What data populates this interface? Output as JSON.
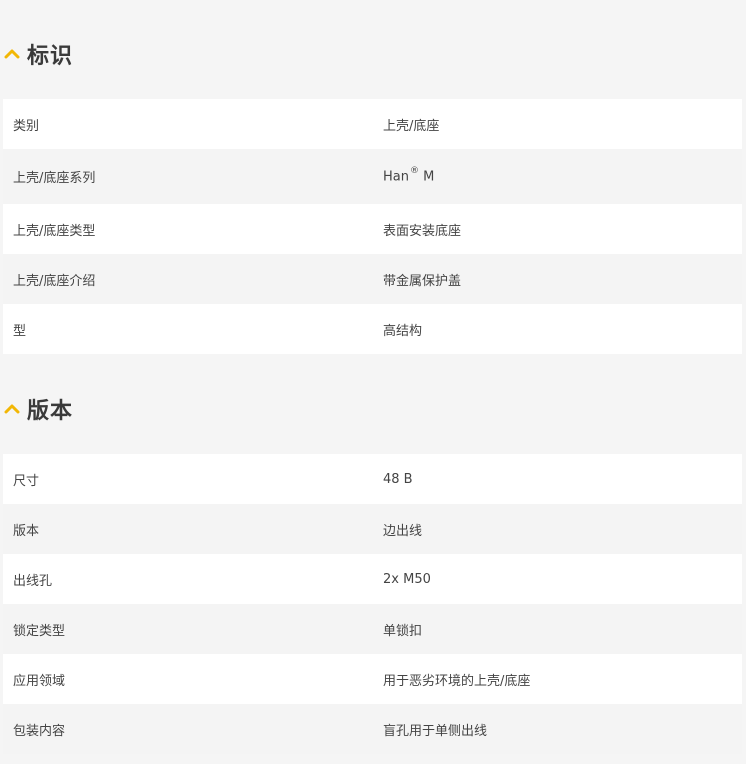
{
  "colors": {
    "accent": "#f2b705",
    "row_white": "#ffffff",
    "row_grey": "#f4f4f4",
    "page_bg": "#f5f5f5"
  },
  "sections": [
    {
      "title": "标识",
      "icon": "chevron-up-icon",
      "rows": [
        {
          "label": "类别",
          "value": "上壳/底座"
        },
        {
          "label": "上壳/底座系列",
          "value": "Han",
          "value_sup": "®",
          "value_after": " M"
        },
        {
          "label": "上壳/底座类型",
          "value": "表面安装底座"
        },
        {
          "label": "上壳/底座介绍",
          "value": "带金属保护盖"
        },
        {
          "label": "型",
          "value": "高结构"
        }
      ]
    },
    {
      "title": "版本",
      "icon": "chevron-up-icon",
      "rows": [
        {
          "label": "尺寸",
          "value": "48 B"
        },
        {
          "label": "版本",
          "value": "边出线"
        },
        {
          "label": "出线孔",
          "value": "2x M50"
        },
        {
          "label": "锁定类型",
          "value": "单锁扣"
        },
        {
          "label": "应用领域",
          "value": "用于恶劣环境的上壳/底座"
        },
        {
          "label": "包装内容",
          "value": "盲孔用于单侧出线"
        }
      ]
    }
  ]
}
